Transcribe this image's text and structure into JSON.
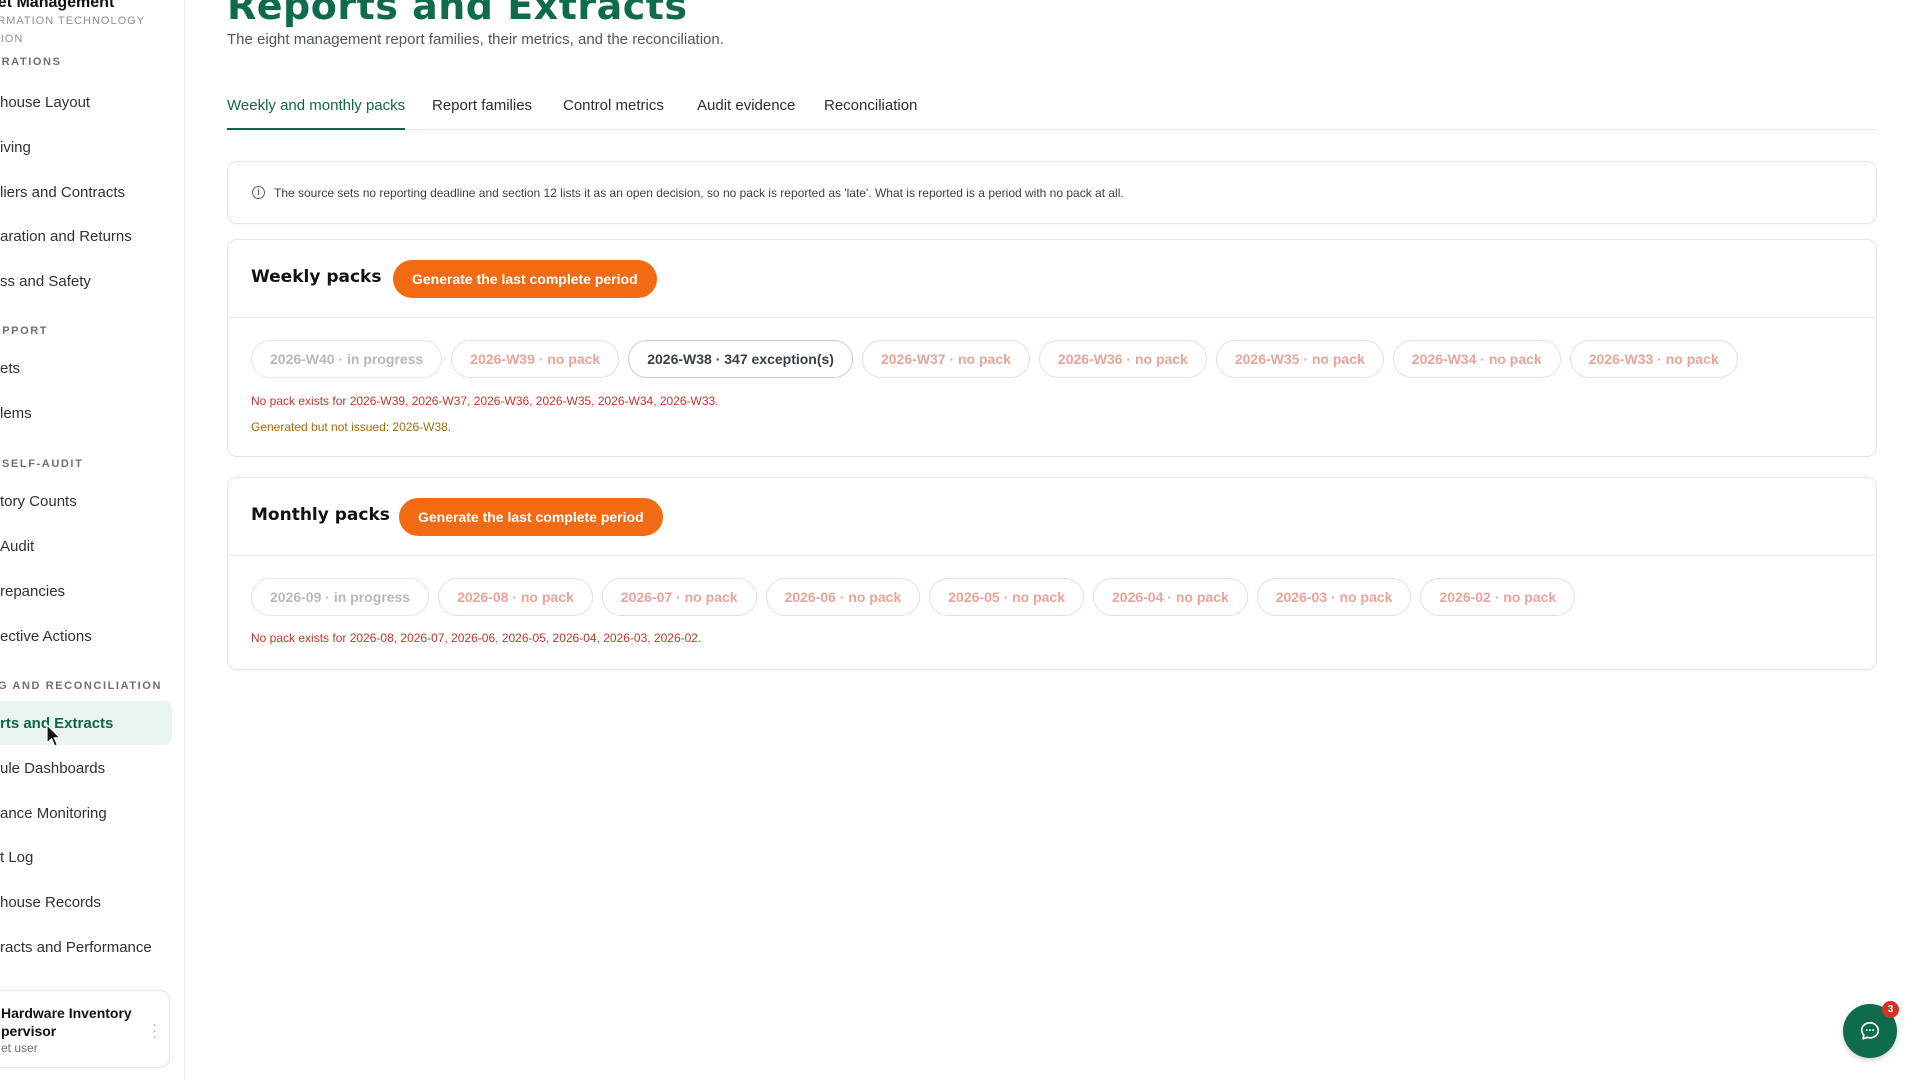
{
  "sidebar": {
    "brand_title": "sset Management",
    "brand_subtitle": "FORMATION TECHNOLOGY\nVISION",
    "sections": [
      {
        "label": "E OPERATIONS"
      },
      {
        "label": "ND SUPPORT"
      },
      {
        "label": "SELF-AUDIT"
      },
      {
        "label": "G AND RECONCILIATION"
      }
    ],
    "items": [
      {
        "label": "house Layout"
      },
      {
        "label": "iving"
      },
      {
        "label": "liers and Contracts"
      },
      {
        "label": "aration and Returns"
      },
      {
        "label": "ss and Safety"
      },
      {
        "label": "ets"
      },
      {
        "label": "lems"
      },
      {
        "label": "tory Counts"
      },
      {
        "label": "Audit"
      },
      {
        "label": "repancies"
      },
      {
        "label": "ective Actions"
      },
      {
        "label": "rts and Extracts"
      },
      {
        "label": "ule Dashboards"
      },
      {
        "label": "ance Monitoring"
      },
      {
        "label": "t Log"
      },
      {
        "label": "house Records"
      },
      {
        "label": "racts and Performance"
      }
    ],
    "user": {
      "name": "Hardware Inventory\npervisor",
      "role": "et user"
    }
  },
  "page": {
    "title": "Reports and Extracts",
    "subtitle": "The eight management report families, their metrics, and the reconciliation."
  },
  "tabs": [
    {
      "label": "Weekly and monthly packs",
      "active": true
    },
    {
      "label": "Report families"
    },
    {
      "label": "Control metrics"
    },
    {
      "label": "Audit evidence"
    },
    {
      "label": "Reconciliation"
    }
  ],
  "notice": {
    "icon": "info-icon",
    "text": "The source sets no reporting deadline and section 12 lists it as an open decision, so no pack is reported as 'late'. What is reported is a period with no pack at all."
  },
  "weekly": {
    "title": "Weekly packs",
    "button": "Generate the last complete period",
    "chips": [
      {
        "label": "2026-W40 · in progress",
        "state": "in-progress"
      },
      {
        "label": "2026-W39 · no pack",
        "state": "no-pack"
      },
      {
        "label": "2026-W38 · 347 exception(s)",
        "state": "exceptions"
      },
      {
        "label": "2026-W37 · no pack",
        "state": "no-pack"
      },
      {
        "label": "2026-W36 · no pack",
        "state": "no-pack"
      },
      {
        "label": "2026-W35 · no pack",
        "state": "no-pack"
      },
      {
        "label": "2026-W34 · no pack",
        "state": "no-pack"
      },
      {
        "label": "2026-W33 · no pack",
        "state": "no-pack"
      }
    ],
    "missing_msg": "No pack exists for 2026-W39, 2026-W37, 2026-W36, 2026-W35, 2026-W34, 2026-W33.",
    "not_issued_msg": "Generated but not issued: 2026-W38."
  },
  "monthly": {
    "title": "Monthly packs",
    "button": "Generate the last complete period",
    "chips": [
      {
        "label": "2026-09 · in progress",
        "state": "in-progress"
      },
      {
        "label": "2026-08 · no pack",
        "state": "no-pack"
      },
      {
        "label": "2026-07 · no pack",
        "state": "no-pack"
      },
      {
        "label": "2026-06 · no pack",
        "state": "no-pack"
      },
      {
        "label": "2026-05 · no pack",
        "state": "no-pack"
      },
      {
        "label": "2026-04 · no pack",
        "state": "no-pack"
      },
      {
        "label": "2026-03 · no pack",
        "state": "no-pack"
      },
      {
        "label": "2026-02 · no pack",
        "state": "no-pack"
      }
    ],
    "missing_msg": "No pack exists for 2026-08, 2026-07, 2026-06, 2026-05, 2026-04, 2026-03, 2026-02."
  },
  "chat": {
    "icon": "chat-icon",
    "badge": "3"
  },
  "colors": {
    "brand": "#0e6b4e",
    "accent": "#f26b12",
    "error": "#c0392b",
    "warning": "#a86a10"
  }
}
